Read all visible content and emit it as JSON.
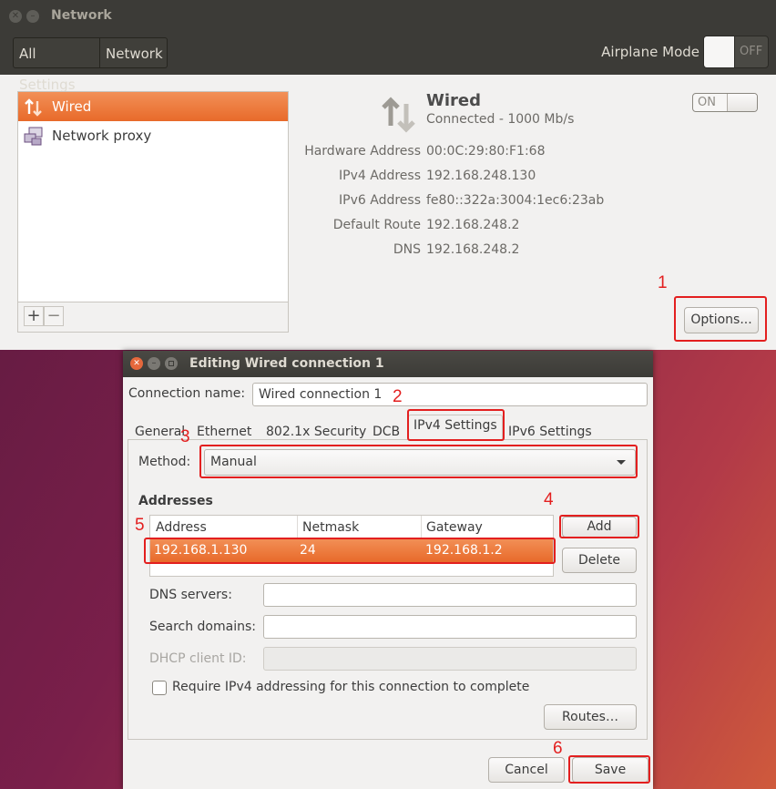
{
  "network_window": {
    "title": "Network",
    "breadcrumbs": [
      "All Settings",
      "Network"
    ],
    "airplane_mode": {
      "label": "Airplane Mode",
      "state": "OFF"
    },
    "sidebar": {
      "items": [
        {
          "label": "Wired",
          "icon": "wired-arrows-icon",
          "selected": true
        },
        {
          "label": "Network proxy",
          "icon": "network-proxy-icon",
          "selected": false
        }
      ],
      "add_label": "+",
      "remove_label": "−"
    },
    "wired": {
      "title": "Wired",
      "status": "Connected - 1000 Mb/s",
      "switch_state": "ON",
      "properties": [
        {
          "key": "Hardware Address",
          "value": "00:0C:29:80:F1:68"
        },
        {
          "key": "IPv4 Address",
          "value": "192.168.248.130"
        },
        {
          "key": "IPv6 Address",
          "value": "fe80::322a:3004:1ec6:23ab"
        },
        {
          "key": "Default Route",
          "value": "192.168.248.2"
        },
        {
          "key": "DNS",
          "value": "192.168.248.2"
        }
      ],
      "options_label": "Options..."
    }
  },
  "dialog": {
    "title": "Editing Wired connection 1",
    "connection_name_label": "Connection name:",
    "connection_name_value": "Wired connection 1",
    "tabs": [
      "General",
      "Ethernet",
      "802.1x Security",
      "DCB",
      "IPv4 Settings",
      "IPv6 Settings"
    ],
    "active_tab": "IPv4 Settings",
    "method_label": "Method:",
    "method_value": "Manual",
    "addresses_heading": "Addresses",
    "columns": [
      "Address",
      "Netmask",
      "Gateway"
    ],
    "rows": [
      {
        "address": "192.168.1.130",
        "netmask": "24",
        "gateway": "192.168.1.2"
      }
    ],
    "add_label": "Add",
    "delete_label": "Delete",
    "dns_label": "DNS servers:",
    "search_domains_label": "Search domains:",
    "dhcp_client_id_label": "DHCP client ID:",
    "require_ipv4_label": "Require IPv4 addressing for this connection to complete",
    "require_ipv4_checked": false,
    "routes_label": "Routes…",
    "cancel_label": "Cancel",
    "save_label": "Save"
  },
  "annotations": [
    "1",
    "2",
    "3",
    "4",
    "5",
    "6"
  ],
  "colors": {
    "accent": "#e86a2a",
    "highlight_box": "#e31f1f",
    "titlebar": "#3c3b37",
    "window_bg": "#f2f1f0"
  }
}
